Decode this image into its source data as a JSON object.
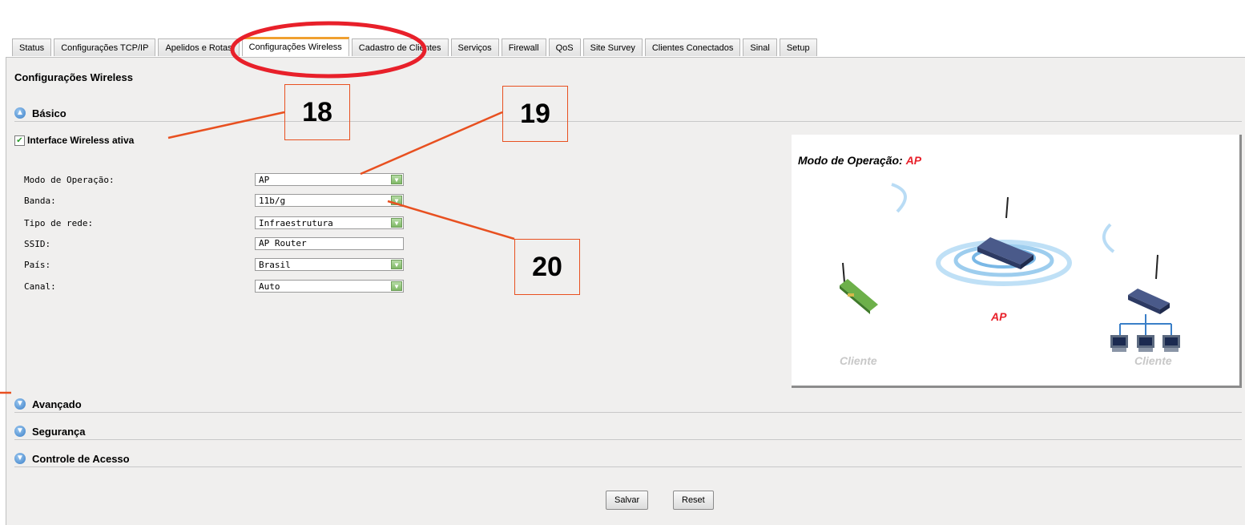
{
  "tabs": [
    {
      "label": "Status"
    },
    {
      "label": "Configurações TCP/IP"
    },
    {
      "label": "Apelidos e Rotas"
    },
    {
      "label": "Configurações Wireless"
    },
    {
      "label": "Cadastro de Clientes"
    },
    {
      "label": "Serviços"
    },
    {
      "label": "Firewall"
    },
    {
      "label": "QoS"
    },
    {
      "label": "Site Survey"
    },
    {
      "label": "Clientes Conectados"
    },
    {
      "label": "Sinal"
    },
    {
      "label": "Setup"
    }
  ],
  "active_tab": "Configurações Wireless",
  "panel": {
    "title": "Configurações Wireless"
  },
  "sections": {
    "basic": "Básico",
    "advanced": "Avançado",
    "security": "Segurança",
    "access_control": "Controle de Acesso"
  },
  "enable_wireless": {
    "label": "Interface Wireless ativa",
    "checked": true
  },
  "form": {
    "mode": {
      "label": "Modo de Operação:",
      "value": "AP"
    },
    "band": {
      "label": "Banda:",
      "value": "11b/g"
    },
    "network_type": {
      "label": "Tipo de rede:",
      "value": "Infraestrutura"
    },
    "ssid": {
      "label": "SSID:",
      "value": "AP Router"
    },
    "country": {
      "label": "País:",
      "value": "Brasil"
    },
    "channel": {
      "label": "Canal:",
      "value": "Auto"
    }
  },
  "diagram": {
    "title": "Modo de Operação:",
    "mode": "AP",
    "center_label": "AP",
    "client_left": "Cliente",
    "client_right": "Cliente"
  },
  "buttons": {
    "save": "Salvar",
    "reset": "Reset"
  },
  "annotations": {
    "n18": "18",
    "n19": "19",
    "n20": "20"
  },
  "colors": {
    "annotation": "#e85020",
    "mode_red": "#e8202a",
    "tab_active_accent": "#f0a030"
  }
}
